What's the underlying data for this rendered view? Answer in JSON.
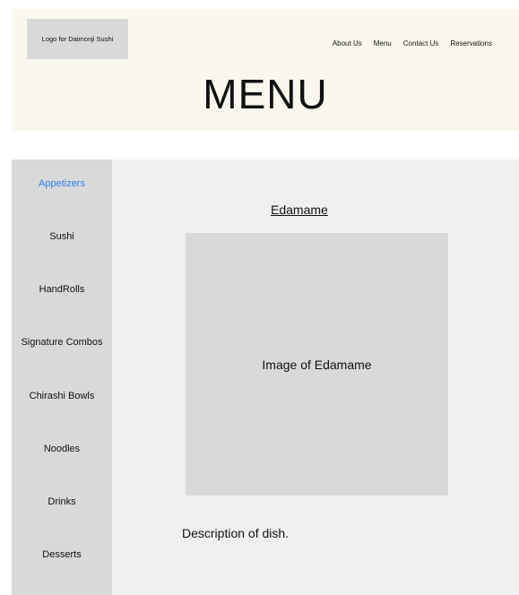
{
  "header": {
    "logo_text": "Logo for Daimonji Sushi",
    "nav": [
      "About Us",
      "Menu",
      "Contact Us",
      "Reservations"
    ],
    "page_title": "MENU"
  },
  "sidebar": {
    "items": [
      {
        "label": "Appetizers",
        "active": true
      },
      {
        "label": "Sushi",
        "active": false
      },
      {
        "label": "HandRolls",
        "active": false
      },
      {
        "label": "Signature Combos",
        "active": false
      },
      {
        "label": "Chirashi Bowls",
        "active": false
      },
      {
        "label": "Noodles",
        "active": false
      },
      {
        "label": "Drinks",
        "active": false
      },
      {
        "label": "Desserts",
        "active": false
      }
    ]
  },
  "main": {
    "dish_title": "Edamame",
    "image_placeholder": "Image of Edamame",
    "description": "Description of dish."
  },
  "colors": {
    "header_bg": "#faf8ee",
    "placeholder_gray": "#d9d9d9",
    "content_bg": "#f0f0f0",
    "active_link": "#2f7fe8"
  }
}
